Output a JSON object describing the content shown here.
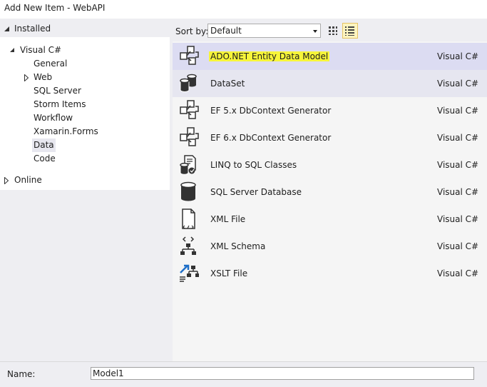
{
  "window": {
    "title": "Add New Item - WebAPI"
  },
  "tree": {
    "installed_label": "Installed",
    "visual_csharp_label": "Visual C#",
    "children": [
      "General",
      "Web",
      "SQL Server",
      "Storm Items",
      "Workflow",
      "Xamarin.Forms",
      "Data",
      "Code"
    ],
    "selected": "Data",
    "online_label": "Online"
  },
  "toolbar": {
    "sort_label": "Sort by:",
    "sort_value": "Default"
  },
  "templates": [
    {
      "name": "ADO.NET Entity Data Model",
      "lang": "Visual C#",
      "icon": "entity-model-icon"
    },
    {
      "name": "DataSet",
      "lang": "Visual C#",
      "icon": "dataset-icon"
    },
    {
      "name": "EF 5.x DbContext Generator",
      "lang": "Visual C#",
      "icon": "entity-model-icon"
    },
    {
      "name": "EF 6.x DbContext Generator",
      "lang": "Visual C#",
      "icon": "entity-model-icon"
    },
    {
      "name": "LINQ to SQL Classes",
      "lang": "Visual C#",
      "icon": "linq-to-sql-icon"
    },
    {
      "name": "SQL Server Database",
      "lang": "Visual C#",
      "icon": "database-icon"
    },
    {
      "name": "XML File",
      "lang": "Visual C#",
      "icon": "xml-file-icon"
    },
    {
      "name": "XML Schema",
      "lang": "Visual C#",
      "icon": "xml-schema-icon"
    },
    {
      "name": "XSLT File",
      "lang": "Visual C#",
      "icon": "xslt-file-icon"
    }
  ],
  "footer": {
    "name_label": "Name:",
    "name_value": "Model1"
  },
  "colors": {
    "selection": "#dcdcf2",
    "highlight": "#f7f53a",
    "pane": "#eeeef2"
  }
}
